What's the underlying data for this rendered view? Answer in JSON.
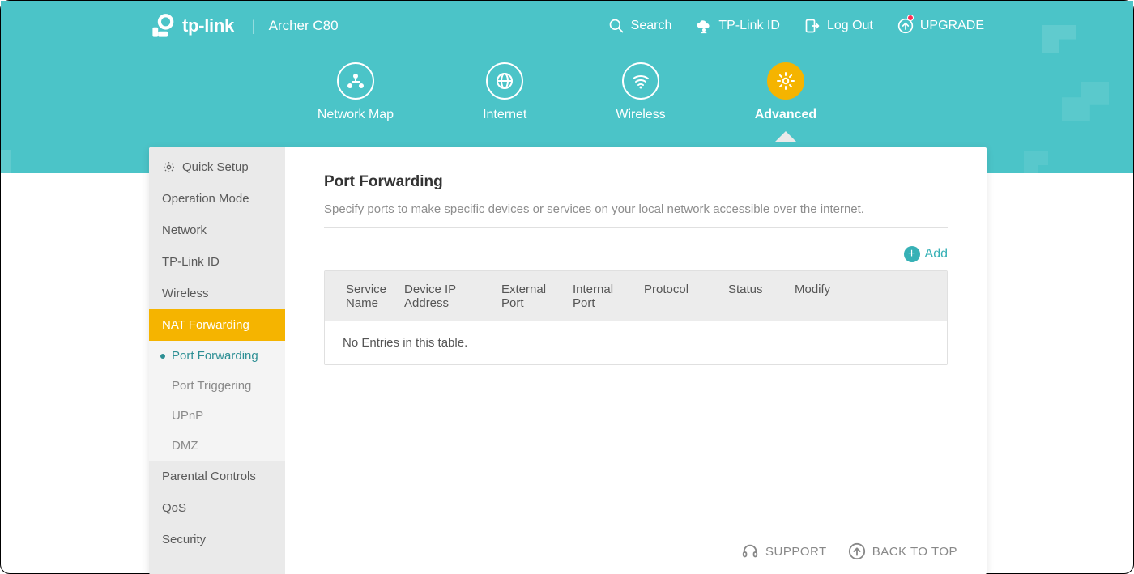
{
  "brand": "tp-link",
  "model": "Archer C80",
  "toplinks": {
    "search": "Search",
    "id": "TP-Link ID",
    "logout": "Log Out",
    "upgrade": "UPGRADE"
  },
  "tabs": {
    "networkmap": "Network Map",
    "internet": "Internet",
    "wireless": "Wireless",
    "advanced": "Advanced"
  },
  "sidebar": {
    "quicksetup": "Quick Setup",
    "opmode": "Operation Mode",
    "network": "Network",
    "tplinkid": "TP-Link ID",
    "wireless": "Wireless",
    "natforward": "NAT Forwarding",
    "sub": {
      "portforward": "Port Forwarding",
      "porttrigger": "Port Triggering",
      "upnp": "UPnP",
      "dmz": "DMZ"
    },
    "parental": "Parental Controls",
    "qos": "QoS",
    "security": "Security"
  },
  "page": {
    "title": "Port Forwarding",
    "desc": "Specify ports to make specific devices or services on your local network accessible over the internet.",
    "add": "Add",
    "columns": {
      "service": "Service Name",
      "deviceip": "Device IP Address",
      "extport": "External Port",
      "intport": "Internal Port",
      "protocol": "Protocol",
      "status": "Status",
      "modify": "Modify"
    },
    "empty": "No Entries in this table."
  },
  "footer": {
    "support": "SUPPORT",
    "backtotop": "BACK TO TOP"
  }
}
